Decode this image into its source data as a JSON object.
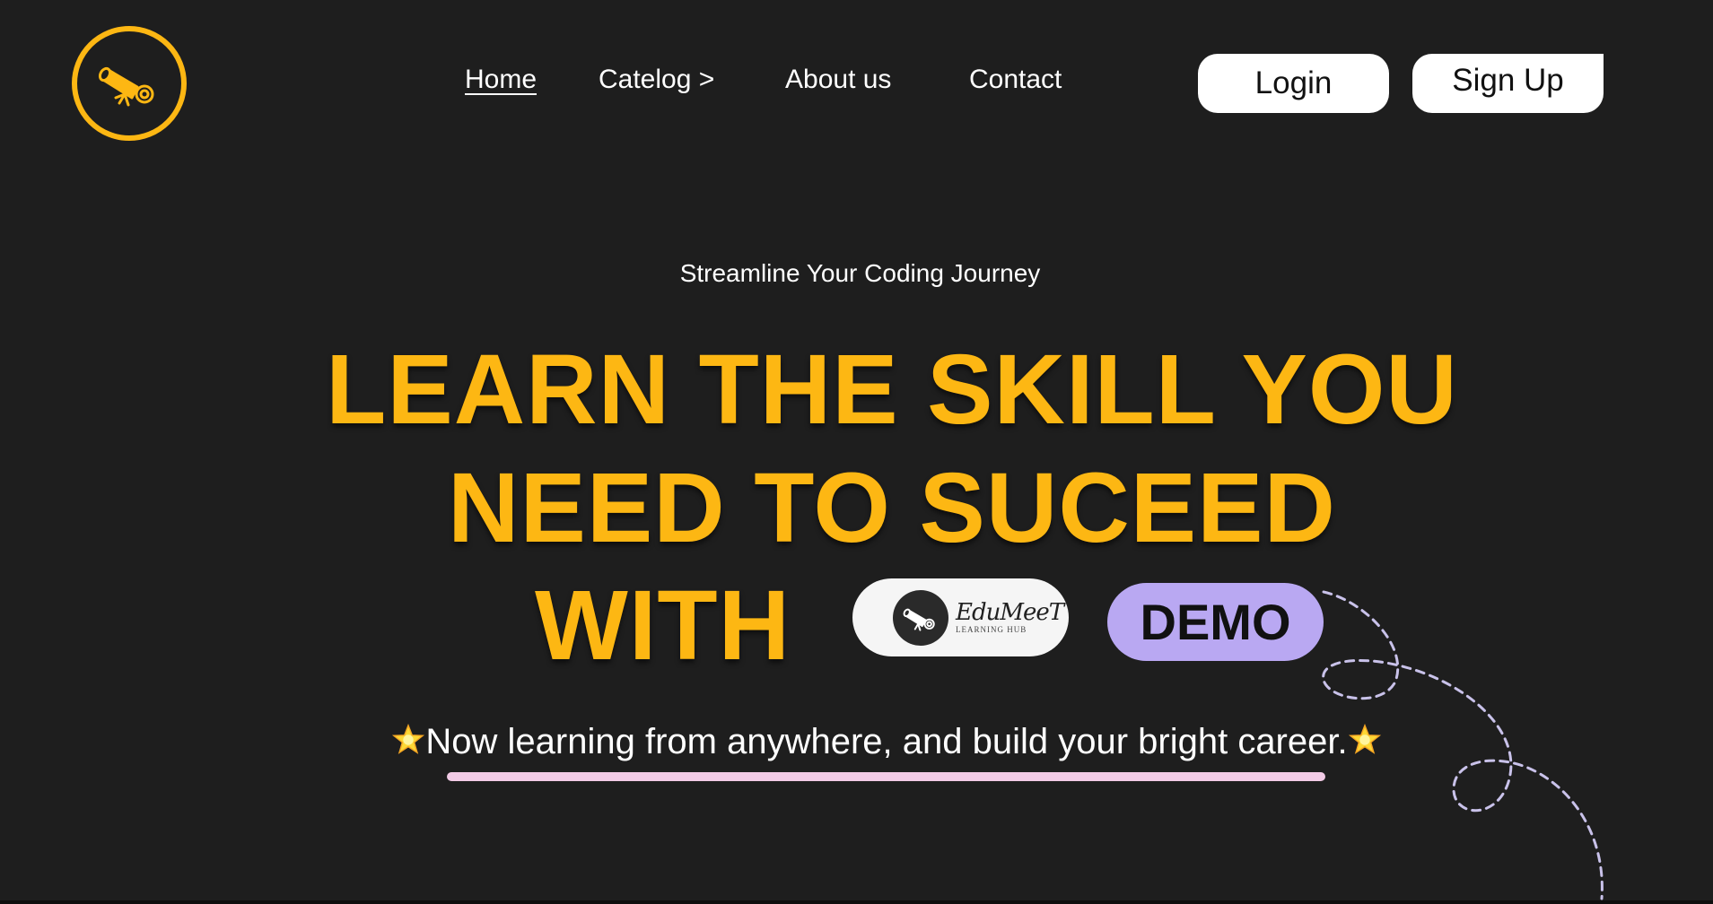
{
  "header": {
    "logo_icon": "scroll-diploma-icon",
    "nav": [
      {
        "label": "Home",
        "active": true
      },
      {
        "label": "Catelog >",
        "active": false
      },
      {
        "label": "About us",
        "active": false
      },
      {
        "label": "Contact",
        "active": false
      }
    ],
    "login_label": "Login",
    "signup_label": "Sign Up"
  },
  "hero": {
    "subtitle": "Streamline Your Coding Journey",
    "headline_line1": "LEARN THE SKILL YOU",
    "headline_line2": "NEED TO SUCEED",
    "headline_line3": "WITH",
    "brand_name": "EduMeeT",
    "brand_tagline": "LEARNING HUB",
    "demo_label": "DEMO",
    "tagline": "Now learning from anywhere, and build your bright career."
  },
  "colors": {
    "background": "#1e1e1e",
    "accent_yellow": "#fdb713",
    "demo_purple": "#b9a8f2",
    "underline_pink": "#f2cbe6",
    "white": "#ffffff"
  }
}
